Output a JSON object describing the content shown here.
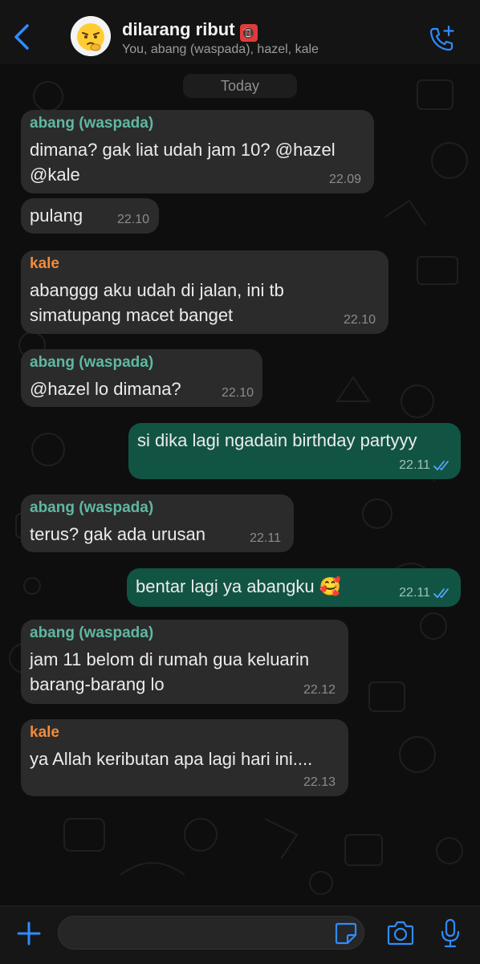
{
  "header": {
    "title": "dilarang ribut",
    "title_emoji": "📵",
    "subtitle": "You, abang (waspada), hazel, kale"
  },
  "chat": {
    "date_label": "Today",
    "messages": [
      {
        "direction": "in",
        "sender": "abang (waspada)",
        "sender_color": "#5fb8a2",
        "lines": [
          "dimana? gak liat udah jam 10? @hazel",
          "@kale"
        ],
        "time": "22.09"
      },
      {
        "direction": "in",
        "sender": "",
        "lines": [
          "pulang"
        ],
        "time": "22.10"
      },
      {
        "direction": "in",
        "sender": "kale",
        "sender_color": "#f08c3c",
        "lines": [
          "abanggg aku udah di jalan, ini tb",
          "simatupang macet banget"
        ],
        "time": "22.10"
      },
      {
        "direction": "in",
        "sender": "abang (waspada)",
        "sender_color": "#5fb8a2",
        "lines": [
          "@hazel lo dimana?"
        ],
        "time": "22.10"
      },
      {
        "direction": "out",
        "sender": "",
        "lines": [
          "si dika lagi ngadain birthday partyyy"
        ],
        "time": "22.11"
      },
      {
        "direction": "in",
        "sender": "abang (waspada)",
        "sender_color": "#5fb8a2",
        "lines": [
          "terus? gak ada urusan"
        ],
        "time": "22.11"
      },
      {
        "direction": "out",
        "sender": "",
        "lines": [
          "bentar lagi ya abangku 🥰"
        ],
        "time": "22.11"
      },
      {
        "direction": "in",
        "sender": "abang (waspada)",
        "sender_color": "#5fb8a2",
        "lines": [
          "jam 11 belom di rumah gua keluarin",
          "barang-barang lo"
        ],
        "time": "22.12"
      },
      {
        "direction": "in",
        "sender": "kale",
        "sender_color": "#f08c3c",
        "lines": [
          "ya Allah keributan apa lagi hari ini...."
        ],
        "time": "22.13"
      }
    ]
  },
  "composer": {
    "input_value": "",
    "input_placeholder": ""
  },
  "colors": {
    "accent": "#2f8cff",
    "incoming_bubble": "#2b2b2b",
    "outgoing_bubble": "#125444",
    "read_ticks": "#53a6ff"
  },
  "icons": {
    "back": "chevron-left-icon",
    "call": "add-call-icon",
    "plus": "plus-icon",
    "sticker": "sticker-icon",
    "camera": "camera-icon",
    "mic": "microphone-icon"
  }
}
